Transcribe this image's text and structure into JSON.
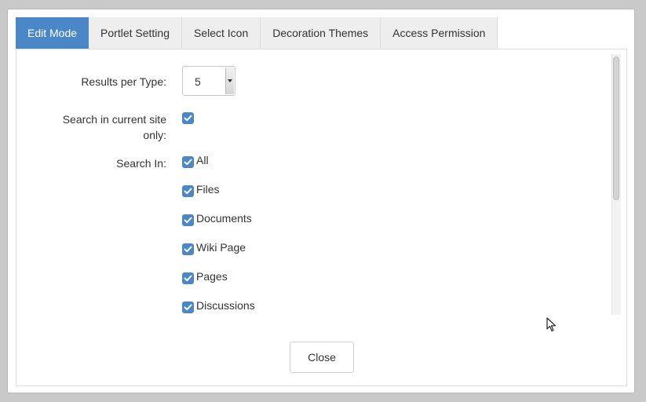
{
  "tabs": [
    "Edit Mode",
    "Portlet Setting",
    "Select Icon",
    "Decoration Themes",
    "Access Permission"
  ],
  "form": {
    "results_per_type_label": "Results per Type:",
    "results_per_type_value": "5",
    "search_current_site_label_line1": "Search in current site",
    "search_current_site_label_line2": "only:",
    "search_current_site_checked": true,
    "search_in_label": "Search In:",
    "search_in_options": [
      {
        "label": "All",
        "checked": true
      },
      {
        "label": "Files",
        "checked": true
      },
      {
        "label": "Documents",
        "checked": true
      },
      {
        "label": "Wiki Page",
        "checked": true
      },
      {
        "label": "Pages",
        "checked": true
      },
      {
        "label": "Discussions",
        "checked": true
      }
    ]
  },
  "close_label": "Close",
  "colors": {
    "accent": "#4a87c8",
    "tab_bg": "#eeeeee",
    "backdrop": "#c9c9c9"
  }
}
